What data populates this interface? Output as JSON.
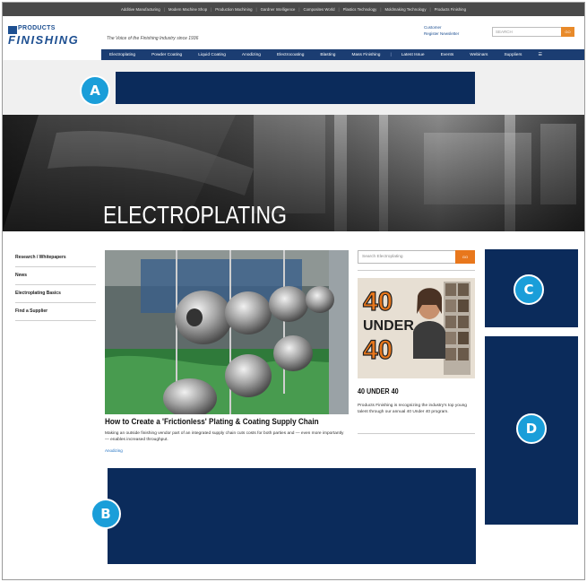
{
  "network_bar": {
    "items": [
      "Additive Manufacturing",
      "Modern Machine Shop",
      "Production Machining",
      "Gardner Intelligence",
      "Composites World",
      "Plastics Technology",
      "Moldmaking Technology",
      "Products Finishing"
    ]
  },
  "header": {
    "logo_top": "PRODUCTS",
    "logo_bottom": "FINISHING",
    "tagline": "The Voice of the Finishing Industry since 1936",
    "account_label": "Customer",
    "register_label": "Register",
    "newsletter_label": "Newsletter",
    "search_placeholder": "SEARCH",
    "search_button": "GO"
  },
  "nav": {
    "items": [
      "Electroplating",
      "Powder Coating",
      "Liquid Coating",
      "Anodizing",
      "Electrocoating",
      "Blasting",
      "Mass Finishing"
    ],
    "right_items": [
      "Latest Issue",
      "Events",
      "Webinars",
      "Suppliers"
    ],
    "more_icon": "menu-icon"
  },
  "hero": {
    "title": "ELECTROPLATING"
  },
  "sidebar": {
    "items": [
      "Research / Whitepapers",
      "News",
      "Electroplating Basics",
      "Find a Supplier"
    ]
  },
  "feature": {
    "title": "How to Create a 'Frictionless' Plating & Coating Supply Chain",
    "description": "Making an outside finishing vendor part of an integrated supply chain cuts costs for both parties and — even more importantly — enables increased throughput.",
    "tag": "Anodizing"
  },
  "right_column": {
    "search_placeholder": "Search Electroplating",
    "search_button": "GO",
    "promo_title": "40 UNDER 40",
    "promo_description": "Products Finishing is recognizing the industry's top young talent through our annual 40 Under 40 program.",
    "promo_image_text_1": "40",
    "promo_image_text_2": "UNDER",
    "promo_image_text_3": "40"
  },
  "ad_labels": {
    "a": "A",
    "b": "B",
    "c": "C",
    "d": "D"
  },
  "colors": {
    "ad_navy": "#0b2b5b",
    "badge_blue": "#1a9ed9",
    "nav_blue": "#1b3d72",
    "accent_orange": "#e8771c"
  }
}
